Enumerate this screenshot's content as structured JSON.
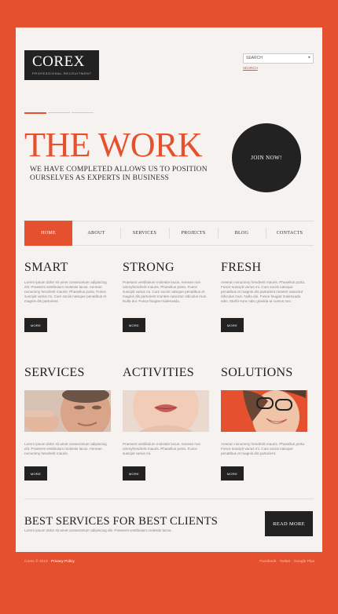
{
  "brand": {
    "name": "COREX",
    "tagline": "PROFESSIONAL RECRUITMENT"
  },
  "search": {
    "placeholder": "SEARCH",
    "link": "SEARCH"
  },
  "hero": {
    "title": "THE WORK",
    "subtitle": "WE HAVE COMPLETED ALLOWS US TO POSITION OURSELVES AS EXPERTS IN BUSINESS",
    "cta": "JOIN NOW!"
  },
  "nav": {
    "items": [
      "HOME",
      "ABOUT",
      "SERVICES",
      "PROJECTS",
      "BLOG",
      "CONTACTS"
    ],
    "active": "HOME"
  },
  "features": [
    {
      "title": "SMART",
      "text": "Lorem ipsum dolor sit amet consectetuer adipiscing elit. Praesent vestibulum molestie lacus. Aenean nonummy hendrerit mauris. Phasellus porta. Fusce suscipit varius mi. Cum sociis natoque penatibus et magnis dis parturient.",
      "button": "MORE"
    },
    {
      "title": "STRONG",
      "text": "Praesent vestibulum molestie lacus. Aenean non ummyhendrerit mauris. Phasellus porta. Fusce suscipit varius mi. Cum sociis natoque penatibus et magnis dis parturient montes nascetur ridiculus mus. Nulla dui. Fusce feugiat malesuada.",
      "button": "MORE"
    },
    {
      "title": "FRESH",
      "text": "Aenean nonummy hendrerit mauris. Phasellus porta. Fusce suscipit varius mi. Cum sociis natoque penatibus et magnis dis parturient montes nascetur ridiculus mus. Nulla dui. Fusce feugiat malesuada odio. Morbi nunc odio gravida at cursus nec.",
      "button": "MORE"
    }
  ],
  "sections": [
    {
      "title": "SERVICES",
      "text": "Lorem ipsum dolor sit amet consectetuer adipiscing elit. Praesent vestibulum molestie lacus. Aenean nonummy hendrerit mauris.",
      "button": "MORE"
    },
    {
      "title": "ACTIVITIES",
      "text": "Praesent vestibulum molestie lacus. Aenean non ummyhendrerit mauris. Phasellus porta. Fusce suscipit varius mi.",
      "button": "MORE"
    },
    {
      "title": "SOLUTIONS",
      "text": "Aenean nonummy hendrerit mauris. Phasellus porta. Fusce suscipit varius mi. Cum sociis natoque penatibus et magnis dis parturient.",
      "button": "MORE"
    }
  ],
  "bottom": {
    "title": "BEST SERVICES FOR BEST CLIENTS",
    "subtitle": "Lorem ipsum dolor sit amet consectetuer adipiscing elit. Praesent vestibulum molestie lacus.",
    "button": "READ MORE"
  },
  "footer": {
    "copyright": "Corex © 2013 · ",
    "privacy": "Privacy Policy",
    "social": "Facebook · Twitter · Google Plus"
  },
  "colors": {
    "accent": "#e5512f",
    "dark": "#222222",
    "card": "#f5f2f0"
  }
}
